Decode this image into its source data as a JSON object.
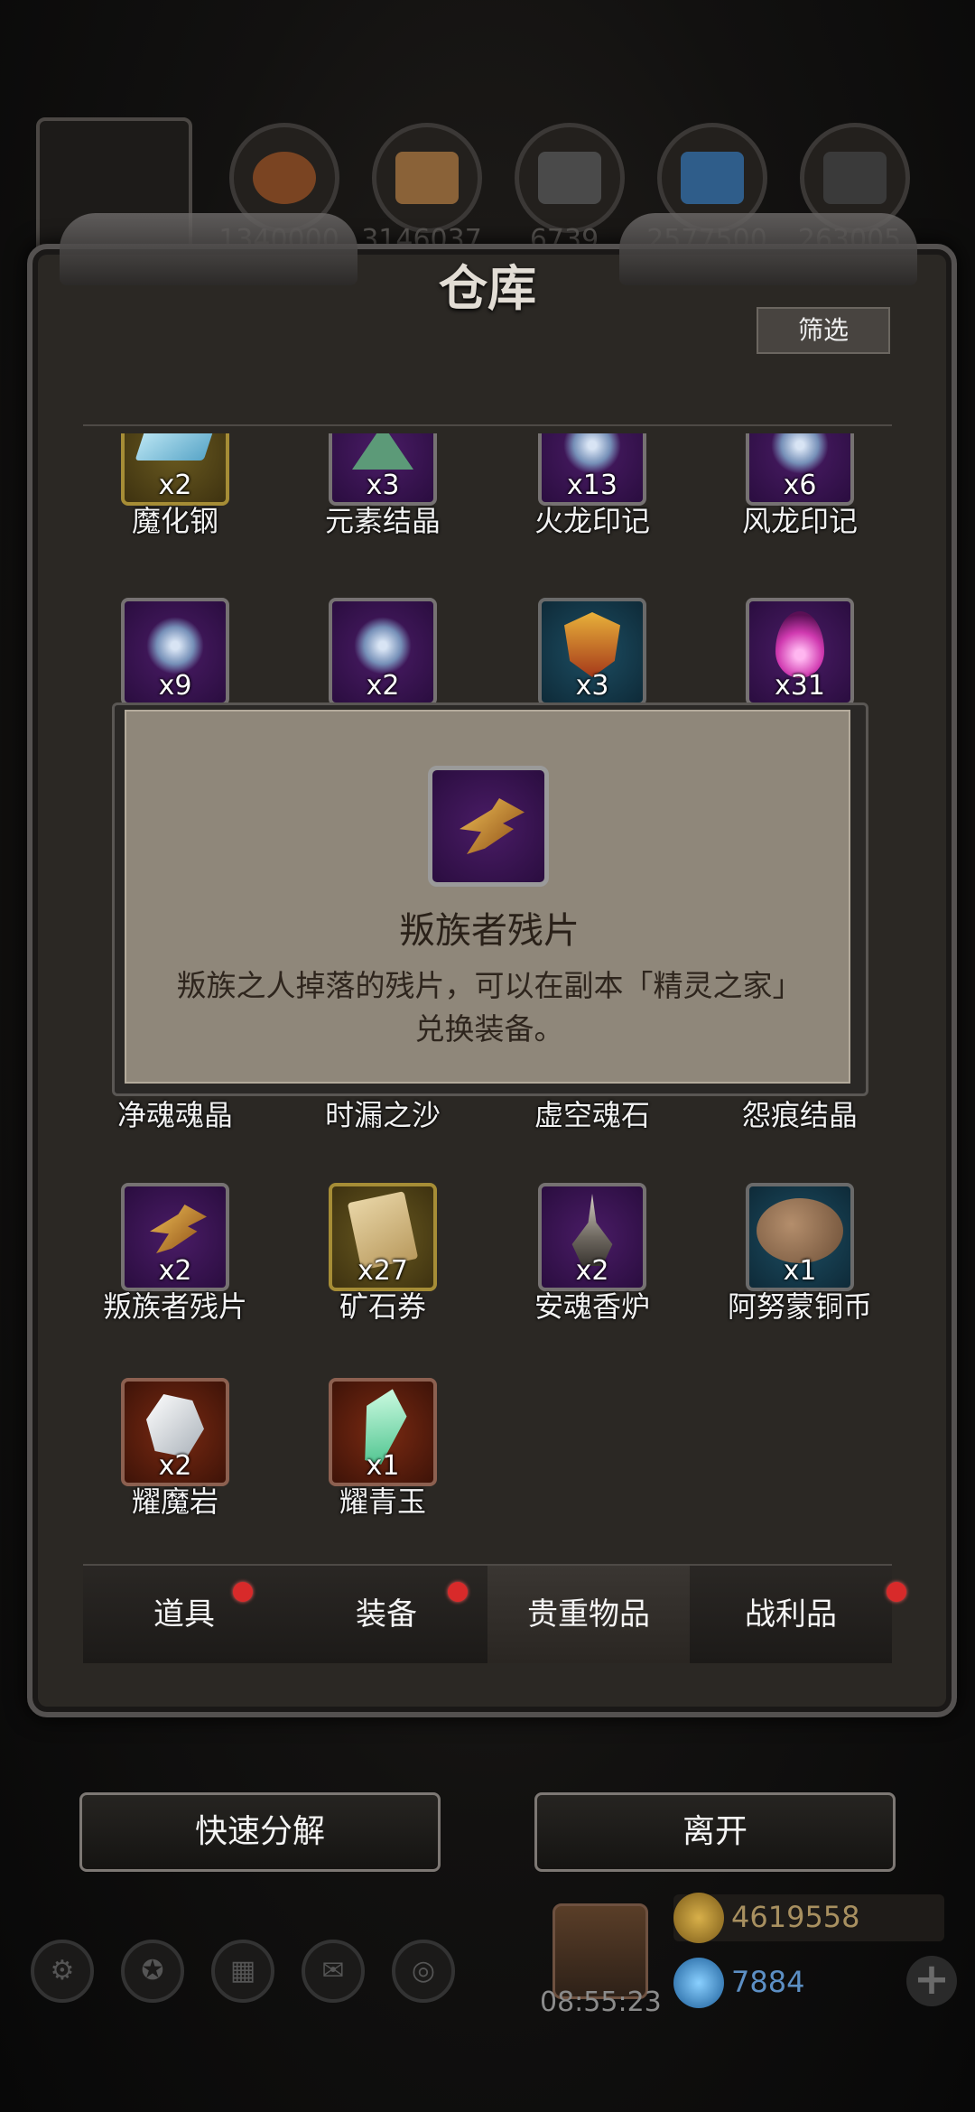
{
  "top_resources": {
    "values": [
      "1340000",
      "3146037",
      "6739",
      "2577500",
      "263005"
    ]
  },
  "window": {
    "title": "仓库",
    "filter_label": "筛选"
  },
  "items": [
    {
      "name": "魔化钢",
      "count": "x2",
      "frame": "gold",
      "icon": "ingot-icon"
    },
    {
      "name": "元素结晶",
      "count": "x3",
      "frame": "purple",
      "icon": "crystal-icon"
    },
    {
      "name": "火龙印记",
      "count": "x13",
      "frame": "purple",
      "icon": "swirl-icon"
    },
    {
      "name": "风龙印记",
      "count": "x6",
      "frame": "purple",
      "icon": "swirl-icon"
    },
    {
      "name": "",
      "count": "x9",
      "frame": "purple",
      "icon": "swirl-icon"
    },
    {
      "name": "",
      "count": "x2",
      "frame": "purple",
      "icon": "swirl-icon"
    },
    {
      "name": "",
      "count": "x3",
      "frame": "blue",
      "icon": "shield-icon"
    },
    {
      "name": "",
      "count": "x31",
      "frame": "purple",
      "icon": "flame-icon"
    },
    {
      "name": "叛族者残片",
      "count": "x2",
      "frame": "purple",
      "icon": "shard-icon"
    },
    {
      "name": "矿石券",
      "count": "x27",
      "frame": "gold",
      "icon": "scroll-icon"
    },
    {
      "name": "安魂香炉",
      "count": "x2",
      "frame": "purple",
      "icon": "censer-icon"
    },
    {
      "name": "阿努蒙铜币",
      "count": "x1",
      "frame": "blue",
      "icon": "coin-icon"
    },
    {
      "name": "耀魔岩",
      "count": "x2",
      "frame": "orange",
      "icon": "rock-icon"
    },
    {
      "name": "耀青玉",
      "count": "x1",
      "frame": "orange",
      "icon": "jade-icon"
    }
  ],
  "partial_row_names": [
    "净魂魂晶",
    "时漏之沙",
    "虚空魂石",
    "怨痕结晶"
  ],
  "tabs": [
    {
      "label": "道具",
      "has_dot": true
    },
    {
      "label": "装备",
      "has_dot": true
    },
    {
      "label": "贵重物品",
      "has_dot": false,
      "active": true
    },
    {
      "label": "战利品",
      "has_dot": true
    }
  ],
  "actions": {
    "quick_decompose": "快速分解",
    "leave": "离开"
  },
  "hud": {
    "time": "08:55:23",
    "gold": "4619558",
    "gems": "7884",
    "plus": "+"
  },
  "tooltip": {
    "title": "叛族者残片",
    "description": "叛族之人掉落的残片，可以在副本「精灵之家」兑换装备。",
    "icon": "shard-icon"
  },
  "colors": {
    "badge_red": "#d82a2a",
    "tooltip_bg": "#8f877a"
  }
}
